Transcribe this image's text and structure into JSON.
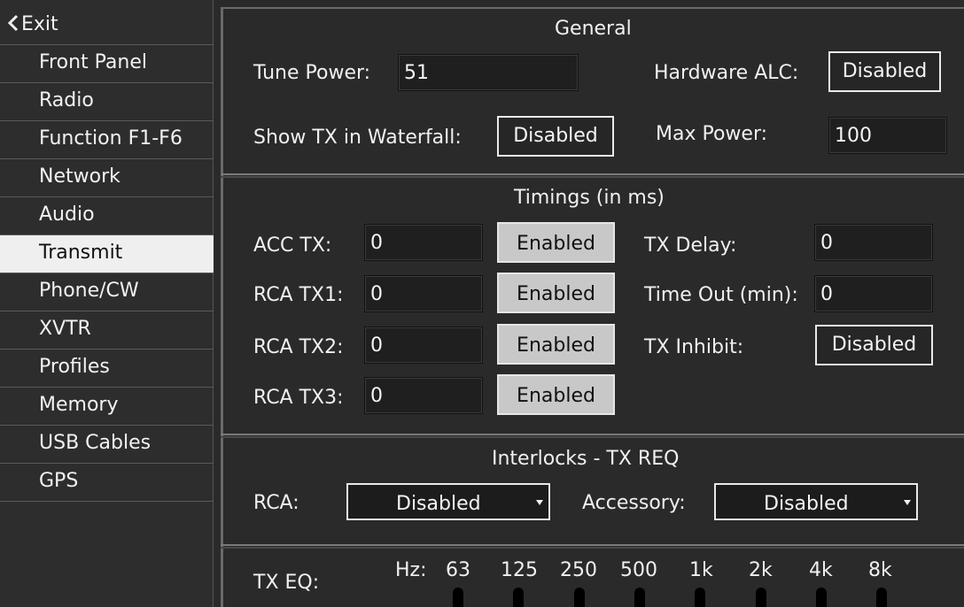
{
  "sidebar": {
    "exit_label": "Exit",
    "items": [
      "Front Panel",
      "Radio",
      "Function F1-F6",
      "Network",
      "Audio",
      "Transmit",
      "Phone/CW",
      "XVTR",
      "Profiles",
      "Memory",
      "USB Cables",
      "GPS"
    ],
    "selected": "Transmit"
  },
  "general": {
    "title": "General",
    "tune_power_label": "Tune Power:",
    "tune_power_value": "51",
    "hardware_alc_label": "Hardware ALC:",
    "hardware_alc_value": "Disabled",
    "show_tx_label": "Show TX in Waterfall:",
    "show_tx_value": "Disabled",
    "max_power_label": "Max Power:",
    "max_power_value": "100"
  },
  "timings": {
    "title": "Timings (in ms)",
    "acc_tx_label": "ACC TX:",
    "acc_tx_value": "0",
    "acc_tx_state": "Enabled",
    "rca_tx1_label": "RCA TX1:",
    "rca_tx1_value": "0",
    "rca_tx1_state": "Enabled",
    "rca_tx2_label": "RCA TX2:",
    "rca_tx2_value": "0",
    "rca_tx2_state": "Enabled",
    "rca_tx3_label": "RCA TX3:",
    "rca_tx3_value": "0",
    "rca_tx3_state": "Enabled",
    "tx_delay_label": "TX Delay:",
    "tx_delay_value": "0",
    "time_out_label": "Time Out (min):",
    "time_out_value": "0",
    "tx_inhibit_label": "TX Inhibit:",
    "tx_inhibit_value": "Disabled"
  },
  "interlocks": {
    "title": "Interlocks - TX REQ",
    "rca_label": "RCA:",
    "rca_value": "Disabled",
    "accessory_label": "Accessory:",
    "accessory_value": "Disabled"
  },
  "tx_eq": {
    "label": "TX EQ:",
    "hz_label": "Hz:",
    "bands": [
      "63",
      "125",
      "250",
      "500",
      "1k",
      "2k",
      "4k",
      "8k"
    ]
  },
  "colors": {
    "background": "#2a2a2a",
    "selected_item": "#efefef",
    "enabled_button": "#c8c8c8"
  }
}
